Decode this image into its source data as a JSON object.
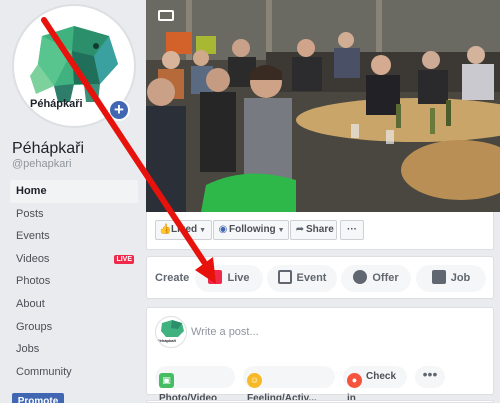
{
  "sidebar": {
    "page_name": "Péhápkaři",
    "handle": "@pehapkari",
    "logo_text": "Péhápkaři",
    "items": [
      {
        "label": "Home",
        "active": true
      },
      {
        "label": "Posts"
      },
      {
        "label": "Events"
      },
      {
        "label": "Videos",
        "badge": "LIVE"
      },
      {
        "label": "Photos"
      },
      {
        "label": "About"
      },
      {
        "label": "Groups"
      },
      {
        "label": "Jobs"
      },
      {
        "label": "Community"
      }
    ],
    "promote_label": "Promote"
  },
  "actions": {
    "liked_label": "Liked",
    "following_label": "Following",
    "share_label": "Share",
    "more_label": "···"
  },
  "create": {
    "label": "Create",
    "live_label": "Live",
    "event_label": "Event",
    "offer_label": "Offer",
    "job_label": "Job"
  },
  "composer": {
    "placeholder": "Write a post...",
    "avatar_text": "Péhápkaři",
    "photo_video_label": "Photo/Video",
    "feeling_label": "Feeling/Activ...",
    "checkin_label": "Check in",
    "more_label": "•••"
  },
  "colors": {
    "facebook_blue": "#4267b2",
    "annotation_red": "#e8120c",
    "logo_green": "#2bb673",
    "logo_dark": "#1a5e52"
  }
}
